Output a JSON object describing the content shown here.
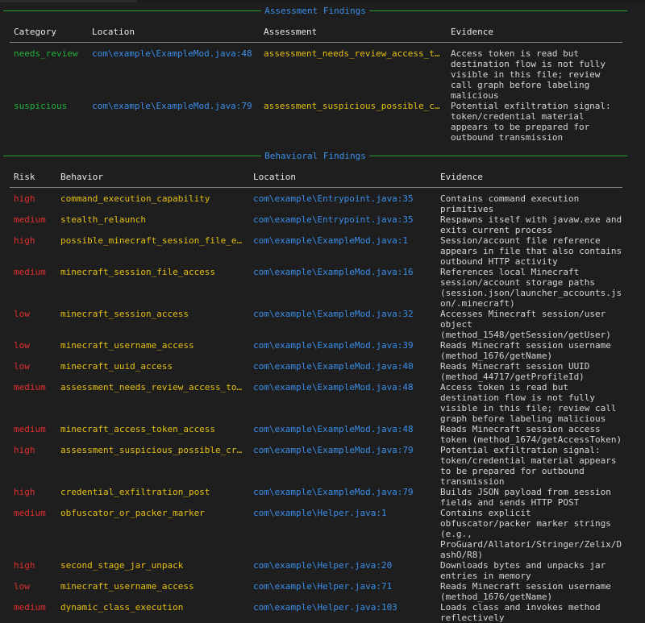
{
  "assessment": {
    "title": "Assessment Findings",
    "headers": {
      "category": "Category",
      "location": "Location",
      "assessment": "Assessment",
      "evidence": "Evidence"
    },
    "rows": [
      {
        "category": "needs_review",
        "location": "com\\example\\ExampleMod.java:48",
        "assessment": "assessment_needs_review_access_t…",
        "evidence": "Access token is read but\ndestination flow is not fully\nvisible in this file; review\ncall graph before labeling\nmalicious"
      },
      {
        "category": "suspicious",
        "location": "com\\example\\ExampleMod.java:79",
        "assessment": "assessment_suspicious_possible_c…",
        "evidence": "Potential exfiltration signal:\ntoken/credential material\nappears to be prepared for\noutbound transmission"
      }
    ]
  },
  "behavioral": {
    "title": "Behavioral Findings",
    "headers": {
      "risk": "Risk",
      "behavior": "Behavior",
      "location": "Location",
      "evidence": "Evidence"
    },
    "rows": [
      {
        "risk": "high",
        "behavior": "command_execution_capability",
        "location": "com\\example\\Entrypoint.java:35",
        "evidence": "Contains command execution\nprimitives"
      },
      {
        "risk": "medium",
        "behavior": "stealth_relaunch",
        "location": "com\\example\\Entrypoint.java:35",
        "evidence": "Respawns itself with javaw.exe and\nexits current process"
      },
      {
        "risk": "high",
        "behavior": "possible_minecraft_session_file_e…",
        "location": "com\\example\\ExampleMod.java:1",
        "evidence": "Session/account file reference\nappears in file that also contains\noutbound HTTP activity"
      },
      {
        "risk": "medium",
        "behavior": "minecraft_session_file_access",
        "location": "com\\example\\ExampleMod.java:16",
        "evidence": "References local Minecraft\nsession/account storage paths\n(session.json/launcher_accounts.js\non/.minecraft)"
      },
      {
        "risk": "low",
        "behavior": "minecraft_session_access",
        "location": "com\\example\\ExampleMod.java:32",
        "evidence": "Accesses Minecraft session/user\nobject\n(method_1548/getSession/getUser)"
      },
      {
        "risk": "low",
        "behavior": "minecraft_username_access",
        "location": "com\\example\\ExampleMod.java:39",
        "evidence": "Reads Minecraft session username\n(method_1676/getName)"
      },
      {
        "risk": "low",
        "behavior": "minecraft_uuid_access",
        "location": "com\\example\\ExampleMod.java:40",
        "evidence": "Reads Minecraft session UUID\n(method_44717/getProfileId)"
      },
      {
        "risk": "medium",
        "behavior": "assessment_needs_review_access_to…",
        "location": "com\\example\\ExampleMod.java:48",
        "evidence": "Access token is read but\ndestination flow is not fully\nvisible in this file; review call\ngraph before labeling malicious"
      },
      {
        "risk": "medium",
        "behavior": "minecraft_access_token_access",
        "location": "com\\example\\ExampleMod.java:48",
        "evidence": "Reads Minecraft session access\ntoken (method_1674/getAccessToken)"
      },
      {
        "risk": "high",
        "behavior": "assessment_suspicious_possible_cr…",
        "location": "com\\example\\ExampleMod.java:79",
        "evidence": "Potential exfiltration signal:\ntoken/credential material appears\nto be prepared for outbound\ntransmission"
      },
      {
        "risk": "high",
        "behavior": "credential_exfiltration_post",
        "location": "com\\example\\ExampleMod.java:79",
        "evidence": "Builds JSON payload from session\nfields and sends HTTP POST"
      },
      {
        "risk": "medium",
        "behavior": "obfuscator_or_packer_marker",
        "location": "com\\example\\Helper.java:1",
        "evidence": "Contains explicit\nobfuscator/packer marker strings\n(e.g.,\nProGuard/Allatori/Stringer/Zelix/D\nashO/R8)"
      },
      {
        "risk": "high",
        "behavior": "second_stage_jar_unpack",
        "location": "com\\example\\Helper.java:20",
        "evidence": "Downloads bytes and unpacks jar\nentries in memory"
      },
      {
        "risk": "low",
        "behavior": "minecraft_username_access",
        "location": "com\\example\\Helper.java:71",
        "evidence": "Reads Minecraft session username\n(method_1676/getName)"
      },
      {
        "risk": "medium",
        "behavior": "dynamic_class_execution",
        "location": "com\\example\\Helper.java:103",
        "evidence": "Loads class and invokes method\nreflectively"
      }
    ]
  }
}
